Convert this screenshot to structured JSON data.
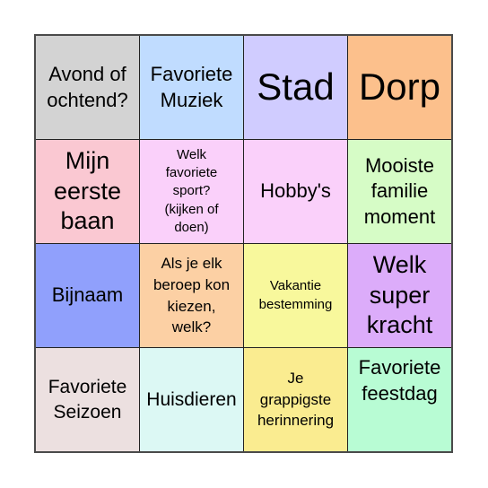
{
  "board": {
    "cells": [
      {
        "text": "Avond of\nochtend?",
        "color": "#d3d3d3"
      },
      {
        "text": "Favoriete\nMuziek",
        "color": "#c0dcff"
      },
      {
        "text": "Stad",
        "color": "#d0ccff"
      },
      {
        "text": "Dorp",
        "color": "#fcc08c"
      },
      {
        "text": "Mijn\neerste\nbaan",
        "color": "#fac8d2"
      },
      {
        "text": "Welk\nfavoriete\nsport?\n(kijken of\ndoen)",
        "color": "#fad0fa"
      },
      {
        "text": "Hobby's",
        "color": "#fad0fa"
      },
      {
        "text": "Mooiste\nfamilie\nmoment",
        "color": "#d6fcc6"
      },
      {
        "text": "Bijnaam",
        "color": "#90a0fc"
      },
      {
        "text": "Als je elk\nberoep kon\nkiezen,\nwelk?",
        "color": "#fcd0a4"
      },
      {
        "text": "Vakantie\nbestemming",
        "color": "#f8f89c"
      },
      {
        "text": "Welk\nsuper\nkracht",
        "color": "#dcacfa"
      },
      {
        "text": "Favoriete\nSeizoen",
        "color": "#ece0e0"
      },
      {
        "text": "Huisdieren",
        "color": "#dcf8f4"
      },
      {
        "text": "Je\ngrappigste\nherinnering",
        "color": "#faec90"
      },
      {
        "text": "Favoriete\nfeestdag",
        "color": "#b8fcd4"
      }
    ]
  }
}
